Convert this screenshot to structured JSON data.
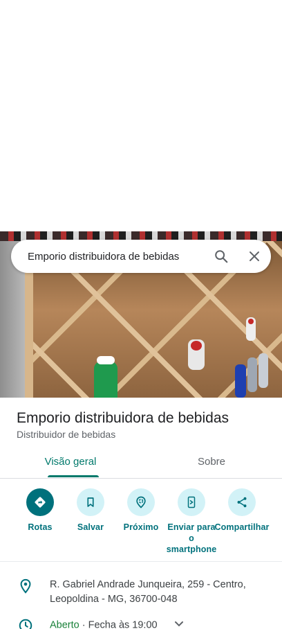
{
  "search": {
    "query": "Emporio distribuidora de bebidas"
  },
  "place": {
    "name": "Emporio distribuidora de bebidas",
    "category": "Distribuidor de bebidas"
  },
  "tabs": [
    {
      "label": "Visão geral",
      "active": true
    },
    {
      "label": "Sobre",
      "active": false
    }
  ],
  "actions": [
    {
      "label": "Rotas",
      "icon": "directions-icon"
    },
    {
      "label": "Salvar",
      "icon": "bookmark-icon"
    },
    {
      "label": "Próximo",
      "icon": "nearby-icon"
    },
    {
      "label": "Enviar para o smartphone",
      "icon": "send-to-phone-icon"
    },
    {
      "label": "Compartilhar",
      "icon": "share-icon"
    }
  ],
  "info": {
    "address_line1": "R. Gabriel Andrade Junqueira, 259 - Centro,",
    "address_line2": "Leopoldina - MG, 36700-048",
    "hours_status": "Aberto",
    "hours_detail": " · Fecha às 19:00"
  },
  "colors": {
    "accent": "#00796b",
    "action_primary": "#00717c",
    "action_bg": "#d2f2f7",
    "open_status": "#188038"
  }
}
